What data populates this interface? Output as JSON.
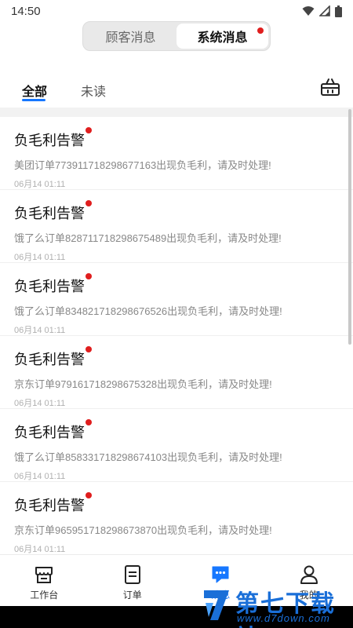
{
  "status_bar": {
    "time": "14:50"
  },
  "segment": {
    "items": [
      {
        "label": "顾客消息",
        "active": false
      },
      {
        "label": "系统消息",
        "active": true
      }
    ]
  },
  "tabs": [
    {
      "label": "全部",
      "active": true
    },
    {
      "label": "未读",
      "active": false
    }
  ],
  "messages": [
    {
      "title": "负毛利告警",
      "text": "美团订单773911718298677163出现负毛利，请及时处理!",
      "time": "06月14 01:11",
      "unread": true
    },
    {
      "title": "负毛利告警",
      "text": "饿了么订单828711718298675489出现负毛利，请及时处理!",
      "time": "06月14 01:11",
      "unread": true
    },
    {
      "title": "负毛利告警",
      "text": "饿了么订单834821718298676526出现负毛利，请及时处理!",
      "time": "06月14 01:11",
      "unread": true
    },
    {
      "title": "负毛利告警",
      "text": "京东订单979161718298675328出现负毛利，请及时处理!",
      "time": "06月14 01:11",
      "unread": true
    },
    {
      "title": "负毛利告警",
      "text": "饿了么订单858331718298674103出现负毛利，请及时处理!",
      "time": "06月14 01:11",
      "unread": true
    },
    {
      "title": "负毛利告警",
      "text": "京东订单965951718298673870出现负毛利，请及时处理!",
      "time": "06月14 01:11",
      "unread": true
    }
  ],
  "bottom_nav": [
    {
      "label": "工作台",
      "icon": "store-icon",
      "active": false
    },
    {
      "label": "订单",
      "icon": "order-icon",
      "active": false
    },
    {
      "label": "消息",
      "icon": "message-icon",
      "active": true
    },
    {
      "label": "我的",
      "icon": "user-icon",
      "active": false
    }
  ],
  "watermark": {
    "title": "第七下载站",
    "url": "www.d7down.com"
  },
  "colors": {
    "accent": "#1677ff",
    "unread_dot": "#e01e1e"
  }
}
